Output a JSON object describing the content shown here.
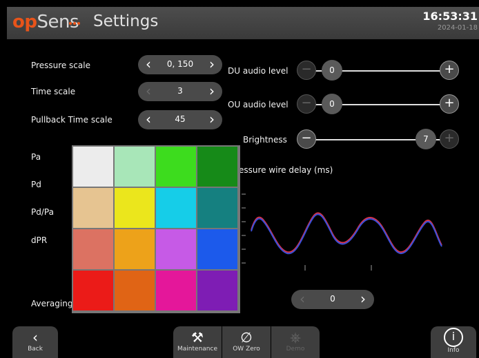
{
  "header": {
    "logo_op": "op",
    "logo_sens": "Sens",
    "title": "Settings",
    "time": "16:53:31",
    "date": "2024-01-18"
  },
  "left": {
    "pressure_scale": {
      "label": "Pressure scale",
      "value": "0, 150"
    },
    "time_scale": {
      "label": "Time scale",
      "value": "3"
    },
    "pullback_time_scale": {
      "label": "Pullback Time scale",
      "value": "45"
    },
    "signals": [
      "Pa",
      "Pd",
      "Pd/Pa",
      "dPR"
    ],
    "averaging": "Averaging"
  },
  "right": {
    "du_audio": {
      "label": "DU audio level",
      "value": "0",
      "level": 0
    },
    "ou_audio": {
      "label": "OU audio level",
      "value": "0",
      "level": 0
    },
    "brightness": {
      "label": "Brightness",
      "value": "7",
      "level": 1.0
    },
    "wire_delay_label": "essure wire delay (ms)",
    "delay_value": "0"
  },
  "palette": {
    "colors": [
      "#ececec",
      "#a8e6b8",
      "#3ddc1e",
      "#168a18",
      "#e6c491",
      "#ebe61c",
      "#16cde8",
      "#158080",
      "#dc7262",
      "#eda21a",
      "#c65ae6",
      "#1c5aeb",
      "#eb1b18",
      "#e06415",
      "#e4179a",
      "#7e1db4"
    ]
  },
  "bottom": {
    "back": "Back",
    "maintenance": "Maintenance",
    "ow_zero": "OW Zero",
    "demo": "Demo",
    "info": "Info"
  },
  "icons": {
    "left": "chevron-left-icon",
    "right": "chevron-right-icon",
    "minus": "minus-icon",
    "plus": "plus-icon"
  }
}
